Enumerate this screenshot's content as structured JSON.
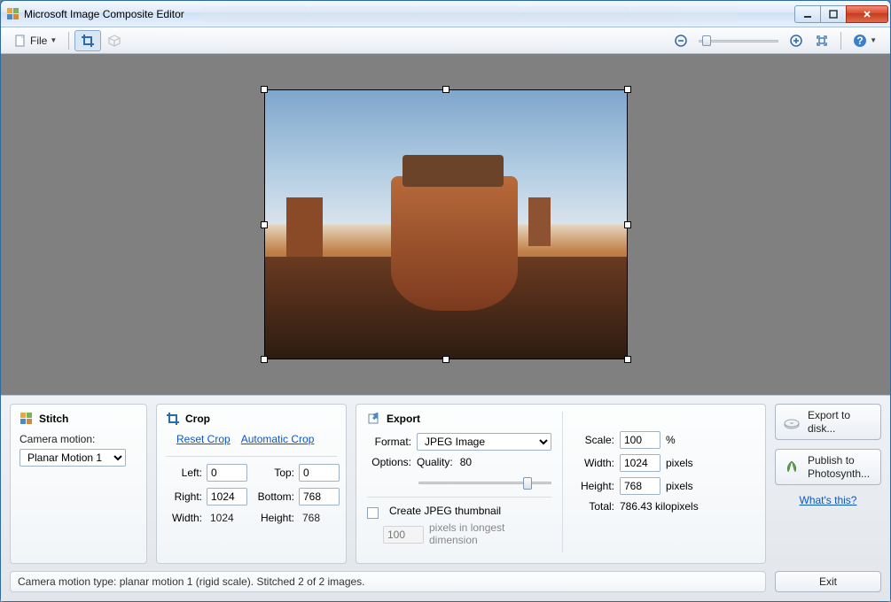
{
  "app": {
    "title": "Microsoft Image Composite Editor"
  },
  "toolbar": {
    "file_label": "File"
  },
  "panels": {
    "stitch": {
      "title": "Stitch",
      "motion_label": "Camera motion:",
      "motion_value": "Planar Motion 1"
    },
    "crop": {
      "title": "Crop",
      "reset_link": "Reset Crop",
      "auto_link": "Automatic Crop",
      "labels": {
        "left": "Left:",
        "top": "Top:",
        "right": "Right:",
        "bottom": "Bottom:",
        "width": "Width:",
        "height": "Height:"
      },
      "values": {
        "left": "0",
        "top": "0",
        "right": "1024",
        "bottom": "768",
        "width": "1024",
        "height": "768"
      }
    },
    "export": {
      "title": "Export",
      "format_label": "Format:",
      "format_value": "JPEG Image",
      "options_label": "Options:",
      "quality_label": "Quality:",
      "quality_value": "80",
      "create_thumb_label": "Create JPEG thumbnail",
      "thumb_px_value": "100",
      "thumb_px_label": "pixels in longest dimension",
      "scale_label": "Scale:",
      "scale_value": "100",
      "scale_unit": "%",
      "width_label": "Width:",
      "width_value": "1024",
      "width_unit": "pixels",
      "height_label": "Height:",
      "height_value": "768",
      "height_unit": "pixels",
      "total_label": "Total:",
      "total_value": "786.43 kilopixels"
    }
  },
  "side": {
    "export_disk": "Export to disk...",
    "publish": "Publish to Photosynth...",
    "whats_this": "What's this?"
  },
  "status": {
    "text": "Camera motion type: planar motion 1 (rigid scale). Stitched 2 of 2 images."
  },
  "exit": {
    "label": "Exit"
  }
}
